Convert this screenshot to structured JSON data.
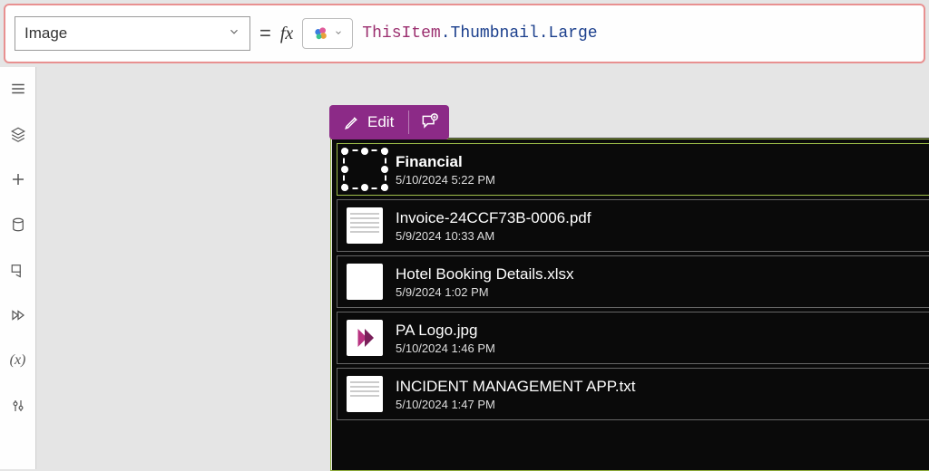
{
  "formula_bar": {
    "property": "Image",
    "equals": "=",
    "fx_label": "fx",
    "expr_kw": "ThisItem",
    "expr_rest": ".Thumbnail.Large"
  },
  "selection_toolbar": {
    "edit_label": "Edit"
  },
  "gallery": {
    "items": [
      {
        "title": "Financial",
        "subtitle": "5/10/2024 5:22 PM",
        "thumb": "none",
        "selected": true
      },
      {
        "title": "Invoice-24CCF73B-0006.pdf",
        "subtitle": "5/9/2024 10:33 AM",
        "thumb": "doc"
      },
      {
        "title": "Hotel Booking Details.xlsx",
        "subtitle": "5/9/2024 1:02 PM",
        "thumb": "blank"
      },
      {
        "title": "PA Logo.jpg",
        "subtitle": "5/10/2024 1:46 PM",
        "thumb": "palogo"
      },
      {
        "title": "INCIDENT MANAGEMENT APP.txt",
        "subtitle": "5/10/2024 1:47 PM",
        "thumb": "doc"
      }
    ]
  },
  "leftnav": {
    "items": [
      "hamburger-icon",
      "layers-icon",
      "plus-icon",
      "database-icon",
      "media-icon",
      "automate-icon",
      "variable-icon",
      "tools-icon"
    ]
  }
}
